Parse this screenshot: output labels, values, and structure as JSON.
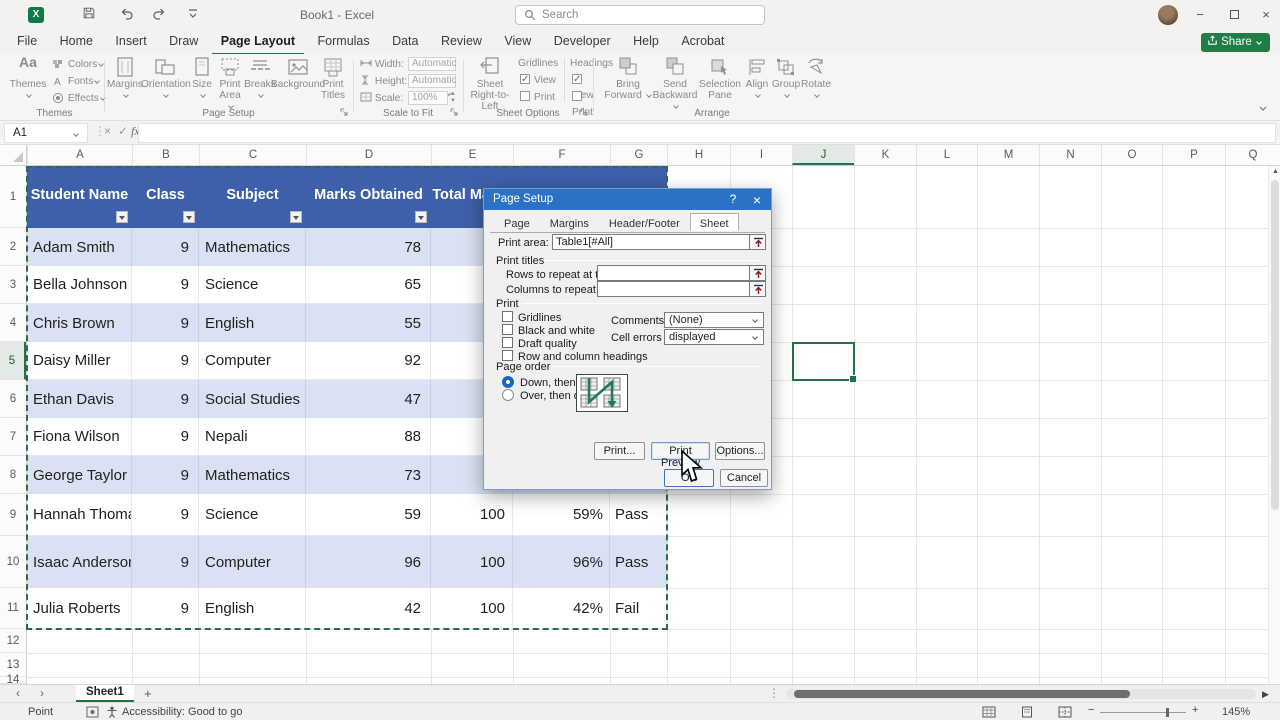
{
  "titlebar": {
    "document_title": "Book1 - Excel",
    "search_placeholder": "Search",
    "minimize": "−",
    "close": "×"
  },
  "menu": {
    "tabs": [
      "File",
      "Home",
      "Insert",
      "Draw",
      "Page Layout",
      "Formulas",
      "Data",
      "Review",
      "View",
      "Developer",
      "Help",
      "Acrobat"
    ],
    "share_label": "Share"
  },
  "ribbon": {
    "themes": {
      "label": "Themes",
      "main": "Themes",
      "items": [
        "Colors",
        "Fonts",
        "Effects"
      ]
    },
    "page_setup": {
      "label": "Page Setup",
      "buttons": [
        "Margins",
        "Orientation",
        "Size",
        "Print Area",
        "Breaks",
        "Background",
        "Print Titles"
      ]
    },
    "scale": {
      "label": "Scale to Fit",
      "width_label": "Width:",
      "width_value": "Automatic",
      "height_label": "Height:",
      "height_value": "Automatic",
      "scale_label": "Scale:",
      "scale_value": "100%"
    },
    "sheet_options": {
      "label": "Sheet Options",
      "rtl": "Sheet Right-to-Left",
      "gridlines": "Gridlines",
      "headings": "Headings",
      "view": "View",
      "print": "Print",
      "gridlines_view": true,
      "gridlines_print": false,
      "headings_view": true,
      "headings_print": false
    },
    "arrange": {
      "label": "Arrange",
      "buttons": [
        "Bring Forward",
        "Send Backward",
        "Selection Pane",
        "Align",
        "Group",
        "Rotate"
      ]
    }
  },
  "formula_bar": {
    "name_box": "A1",
    "fx": "fx",
    "formula": ""
  },
  "grid": {
    "columns": [
      "A",
      "B",
      "C",
      "D",
      "E",
      "F",
      "G",
      "H",
      "I",
      "J",
      "K",
      "L",
      "M",
      "N",
      "O",
      "P",
      "Q"
    ],
    "rows": [
      "1",
      "2",
      "3",
      "4",
      "5",
      "6",
      "7",
      "8",
      "9",
      "10",
      "11",
      "12",
      "13",
      "14"
    ],
    "active_column": "J",
    "active_row": "5"
  },
  "table": {
    "headers": [
      "Student Name",
      "Class",
      "Subject",
      "Marks Obtained",
      "Total Marks",
      "",
      ""
    ],
    "rows": [
      [
        "Adam Smith",
        "9",
        "Mathematics",
        "78",
        "",
        "",
        ""
      ],
      [
        "Bella Johnson",
        "9",
        "Science",
        "65",
        "",
        "",
        ""
      ],
      [
        "Chris Brown",
        "9",
        "English",
        "55",
        "",
        "",
        ""
      ],
      [
        "Daisy Miller",
        "9",
        "Computer",
        "92",
        "",
        "",
        ""
      ],
      [
        "Ethan Davis",
        "9",
        "Social Studies",
        "47",
        "",
        "",
        ""
      ],
      [
        "Fiona Wilson",
        "9",
        "Nepali",
        "88",
        "",
        "",
        ""
      ],
      [
        "George Taylor",
        "9",
        "Mathematics",
        "73",
        "",
        "",
        ""
      ],
      [
        "Hannah Thomas",
        "9",
        "Science",
        "59",
        "100",
        "59%",
        "Pass"
      ],
      [
        "Isaac Anderson",
        "9",
        "Computer",
        "96",
        "100",
        "96%",
        "Pass"
      ],
      [
        "Julia Roberts",
        "9",
        "English",
        "42",
        "100",
        "42%",
        "Fail"
      ]
    ]
  },
  "dialog": {
    "title": "Page Setup",
    "help_label": "?",
    "close_label": "×",
    "tabs": [
      "Page",
      "Margins",
      "Header/Footer",
      "Sheet"
    ],
    "active_tab": "Sheet",
    "print_area_label": "Print area:",
    "print_area_value": "Table1[#All]",
    "print_titles_label": "Print titles",
    "rows_repeat_label": "Rows to repeat at top:",
    "rows_repeat_value": "",
    "cols_repeat_label": "Columns to repeat at left:",
    "cols_repeat_value": "",
    "print_label": "Print",
    "print_options": [
      {
        "label": "Gridlines",
        "checked": false
      },
      {
        "label": "Black and white",
        "checked": false
      },
      {
        "label": "Draft quality",
        "checked": false
      },
      {
        "label": "Row and column headings",
        "checked": false
      }
    ],
    "comments_label": "Comments:",
    "comments_value": "(None)",
    "cell_errors_label": "Cell errors as:",
    "cell_errors_value": "displayed",
    "page_order_label": "Page order",
    "page_order": {
      "options": [
        {
          "label": "Down, then over",
          "selected": true
        },
        {
          "label": "Over, then down",
          "selected": false
        }
      ]
    },
    "buttons": {
      "print": "Print...",
      "print_preview": "Print Preview",
      "options": "Options...",
      "ok": "OK",
      "cancel": "Cancel"
    }
  },
  "tabbar": {
    "prev": "‹",
    "next": "›",
    "sheet": "Sheet1",
    "add": "+"
  },
  "statusbar": {
    "mode": "Point",
    "accessibility": "Accessibility: Good to go",
    "zoom_level": "145%"
  }
}
